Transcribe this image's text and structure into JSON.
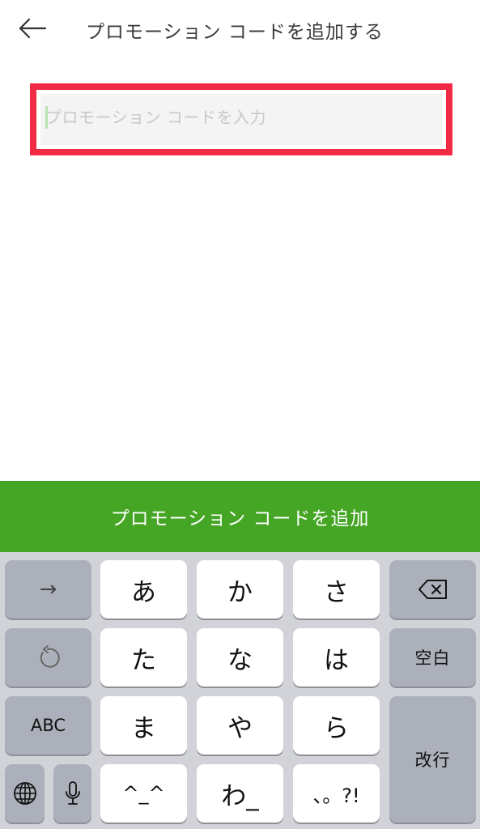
{
  "header": {
    "title": "プロモーション コードを追加する"
  },
  "promo_input": {
    "placeholder": "プロモーション コードを入力",
    "value": ""
  },
  "submit_button": {
    "label": "プロモーション コードを追加"
  },
  "keyboard": {
    "row1": {
      "left": "→",
      "keys": [
        "あ",
        "か",
        "さ"
      ],
      "right_icon": "backspace-icon"
    },
    "row2": {
      "left_icon": "undo-icon",
      "keys": [
        "た",
        "な",
        "は"
      ],
      "right": "空白"
    },
    "row3": {
      "left": "ABC",
      "keys": [
        "ま",
        "や",
        "ら"
      ],
      "return": "改行"
    },
    "row4": {
      "globe_icon": "globe-icon",
      "mic_icon": "microphone-icon",
      "keys": [
        "^_^",
        "わ_",
        "、。?!"
      ]
    }
  },
  "colors": {
    "accent_green": "#45a524",
    "highlight_red": "#f22b44",
    "keyboard_bg": "#d1d3d9"
  }
}
